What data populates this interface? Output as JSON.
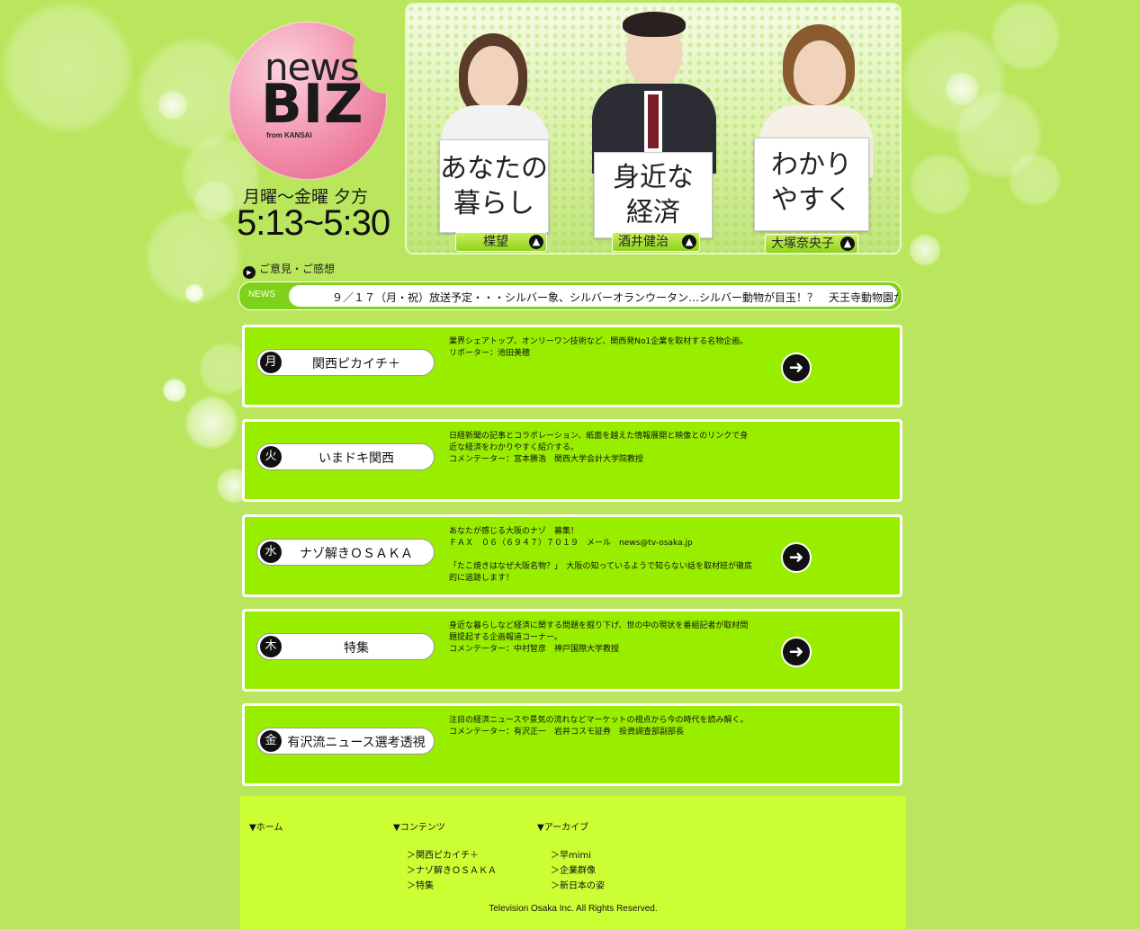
{
  "logo": {
    "news": "news",
    "biz": "BIZ",
    "from": "from KANSAI"
  },
  "schedule": {
    "days": "月曜～金曜 夕方",
    "time": "5:13~5:30"
  },
  "hero": {
    "presenters": [
      {
        "sign_lines": [
          "あなたの",
          "暮らし"
        ],
        "name": "楪望"
      },
      {
        "sign_lines": [
          "身近な",
          "経済"
        ],
        "name": "酒井健治"
      },
      {
        "sign_lines": [
          "わかり",
          "やすく"
        ],
        "name": "大塚奈央子"
      }
    ]
  },
  "feedback": {
    "label": "ご意見・ご感想"
  },
  "ticker": {
    "label": "NEWS",
    "text": "９／１７（月・祝）放送予定・・・シルバー象、シルバーオランウータン…シルバー動物が目玉！？　天王寺動物園が"
  },
  "corners": [
    {
      "day": "月",
      "title": "関西ピカイチ＋",
      "desc": [
        "業界シェアトップ、オンリーワン技術など、関西発No1企業を取材する名物企画。",
        "リポーター：池田美穂"
      ],
      "has_button": true
    },
    {
      "day": "火",
      "title": "いまドキ関西",
      "desc": [
        "日経新聞の記事とコラボレーション、紙面を越えた情報展開と映像とのリンクで身近な経済をわかりやすく紹介する。",
        "コメンテーター：宮本勝浩　関西大学会計大学院教授"
      ],
      "has_button": false
    },
    {
      "day": "水",
      "title": "ナゾ解きＯＳＡＫＡ",
      "desc": [
        "あなたが感じる大阪のナゾ　募集！",
        "ＦＡＸ　０６（６９４７）７０１９　メール　news@tv-osaka.jp",
        "",
        "「たこ焼きはなぜ大阪名物？」　大阪の知っているようで知らない話を取材班が徹底的に追跡します！"
      ],
      "has_button": true
    },
    {
      "day": "木",
      "title": "特集",
      "desc": [
        "身近な暮らしなど経済に関する問題を掘り下げ、世の中の現状を番組記者が取材問題提起する企画報道コーナー。",
        "コメンテーター：中村智彦　神戸国際大学教授"
      ],
      "has_button": true
    },
    {
      "day": "金",
      "title": "有沢流ニュース選考透視",
      "desc": [
        "注目の経済ニュースや景気の流れなどマーケットの視点から今の時代を読み解く。",
        "コメンテーター：有沢正一　岩井コスモ証券　投資調査部副部長"
      ],
      "has_button": false
    }
  ],
  "footer": {
    "home": "▼ホーム",
    "contents": {
      "heading": "▼コンテンツ",
      "links": [
        "＞関西ピカイチ＋",
        "＞ナゾ解きＯＳＡＫＡ",
        "＞特集"
      ]
    },
    "archive": {
      "heading": "▼アーカイブ",
      "links": [
        "＞早mimi",
        "＞企業群像",
        "＞新日本の姿"
      ]
    },
    "copyright": "Television Osaka Inc. All Rights Reserved."
  },
  "colors": {
    "background": "#b9e65c",
    "box": "#99ee00",
    "footer": "#ccff33",
    "logo": "#f08aaa"
  }
}
